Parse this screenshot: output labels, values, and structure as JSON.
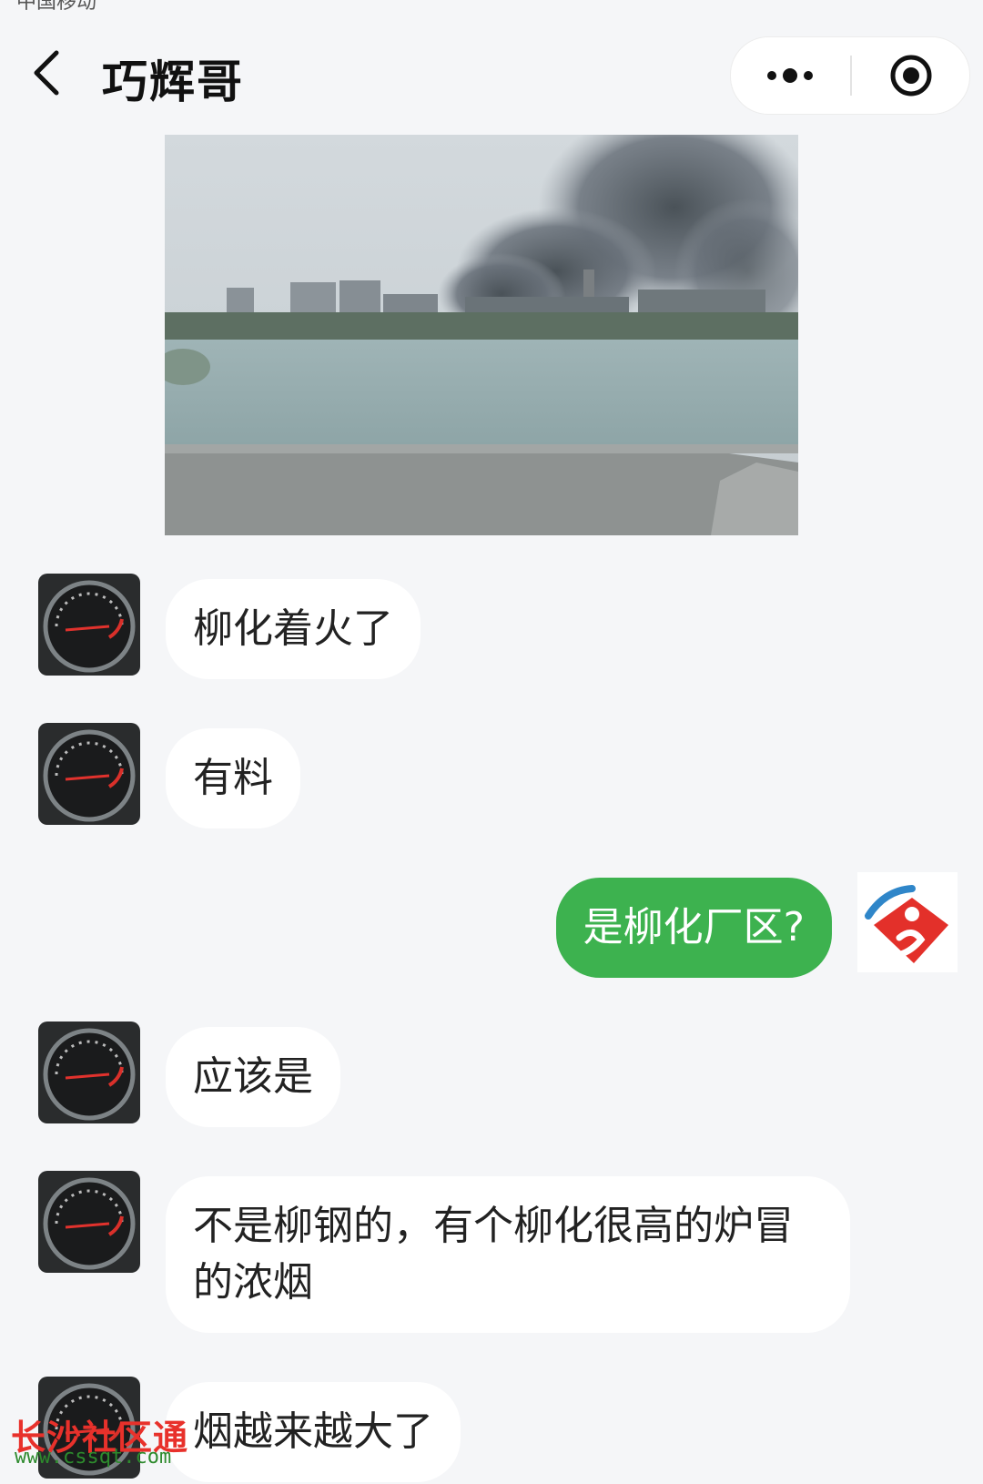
{
  "status_bar": {
    "carrier": "中国移动"
  },
  "header": {
    "title": "巧辉哥",
    "back_icon": "chevron-left-icon",
    "more_icon": "more-dots-icon",
    "close_icon": "target-circle-icon"
  },
  "messages": [
    {
      "type": "image",
      "sender": "other",
      "icon": "photo-factory-smoke"
    },
    {
      "type": "text",
      "sender": "other",
      "text": "柳化着火了"
    },
    {
      "type": "text",
      "sender": "other",
      "text": "有料"
    },
    {
      "type": "text",
      "sender": "me",
      "text": "是柳化厂区?"
    },
    {
      "type": "text",
      "sender": "other",
      "text": "应该是"
    },
    {
      "type": "text",
      "sender": "other",
      "text": "不是柳钢的，有个柳化很高的炉冒的浓烟"
    },
    {
      "type": "text",
      "sender": "other",
      "text": "烟越来越大了"
    }
  ],
  "watermark": {
    "title": "长沙社区通",
    "url": "www.cssqt.com"
  },
  "colors": {
    "outgoing_bubble": "#3db24f",
    "incoming_bubble": "#ffffff",
    "background": "#f5f6f8"
  }
}
